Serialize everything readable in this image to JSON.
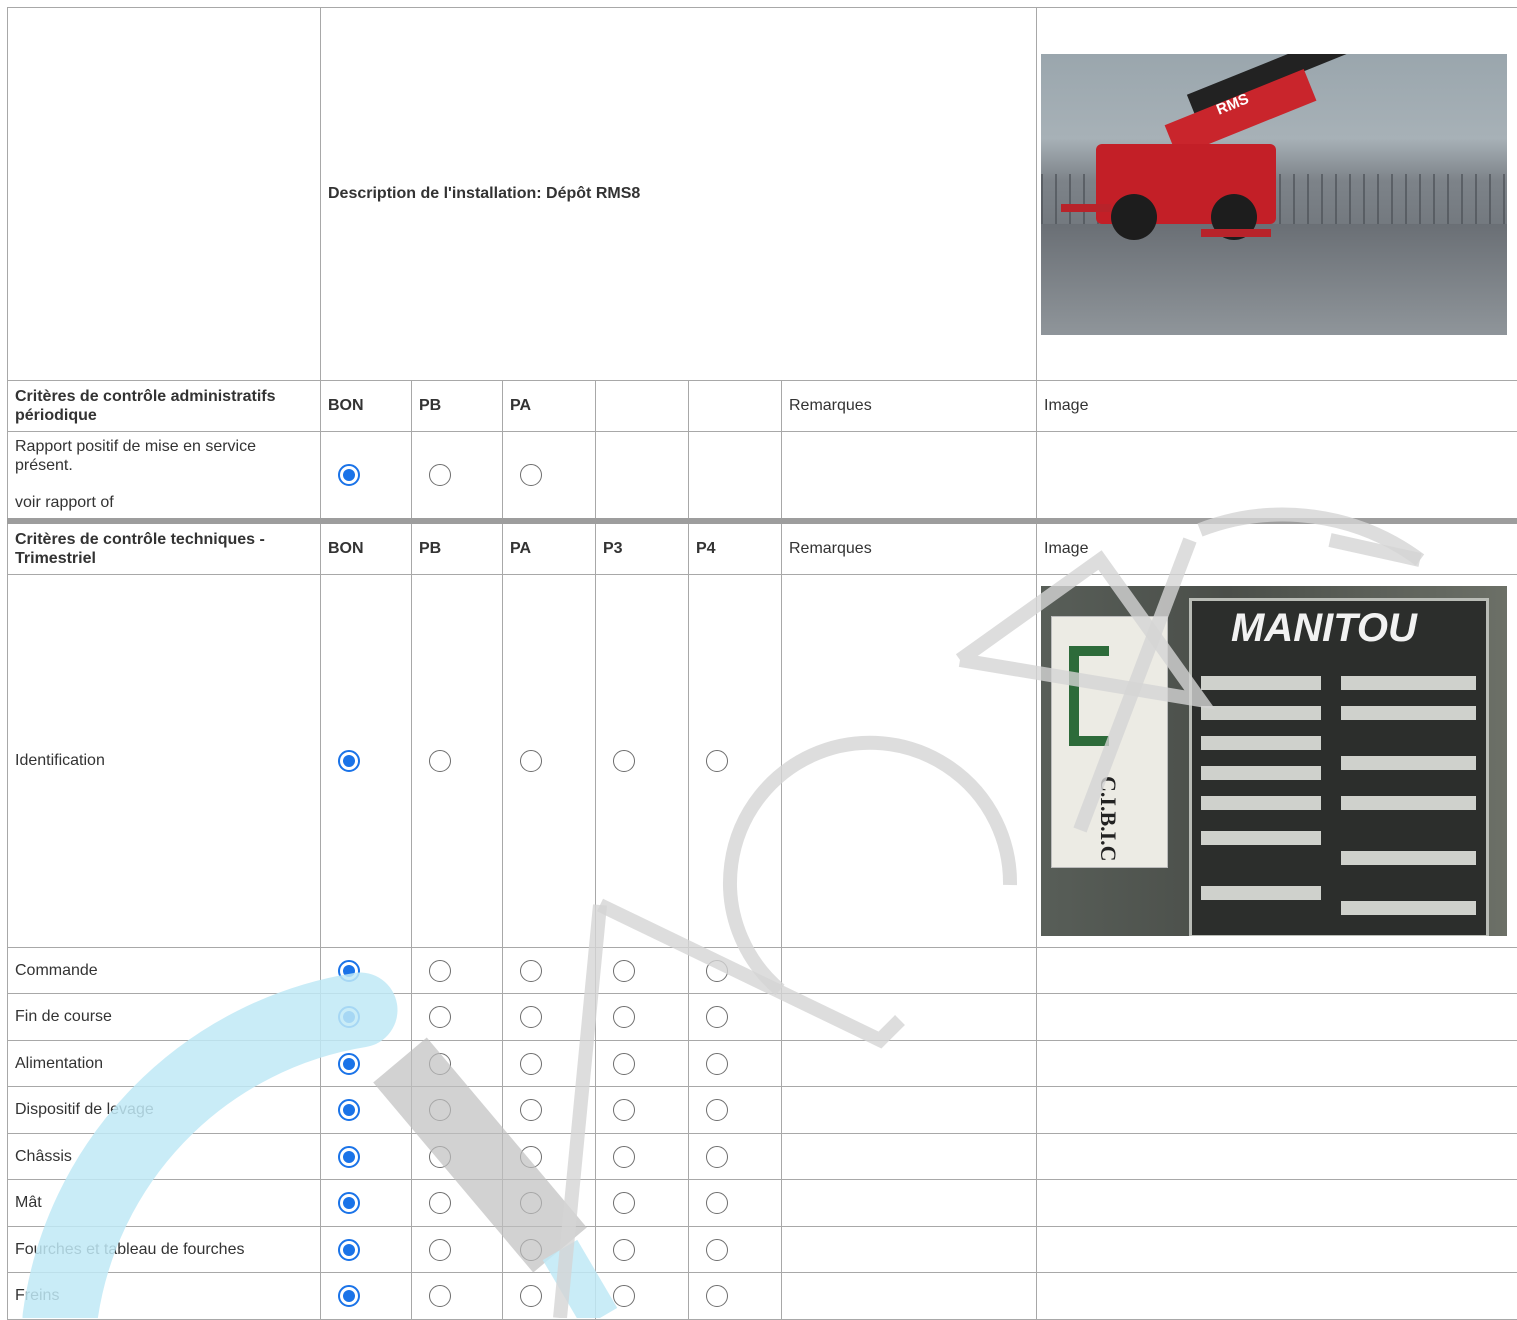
{
  "description": "Description de l'installation: Dépôt RMS8",
  "admin_header": {
    "title": "Critères de contrôle administratifs périodique",
    "cols": [
      "BON",
      "PB",
      "PA",
      "",
      ""
    ],
    "remarks": "Remarques",
    "image": "Image"
  },
  "admin_rows": [
    {
      "label": "Rapport positif de mise en service présent.",
      "note": "voir rapport of",
      "selected": 0
    }
  ],
  "tech_header": {
    "title": "Critères de contrôle techniques - Trimestriel",
    "cols": [
      "BON",
      "PB",
      "PA",
      "P3",
      "P4"
    ],
    "remarks": "Remarques",
    "image": "Image"
  },
  "tech_rows": [
    {
      "label": "Identification",
      "selected": 0
    },
    {
      "label": "Commande",
      "selected": 0
    },
    {
      "label": "Fin de course",
      "selected": 0
    },
    {
      "label": "Alimentation",
      "selected": 0
    },
    {
      "label": "Dispositif de levage",
      "selected": 0
    },
    {
      "label": "Châssis",
      "selected": 0
    },
    {
      "label": "Mât",
      "selected": 0
    },
    {
      "label": "Fourches et tableau de fourches",
      "selected": 0
    },
    {
      "label": "Freins",
      "selected": 0
    }
  ],
  "photos": {
    "machine_marking": "RMS",
    "plate_brand": "MANITOU",
    "sticker_text": "C.I.B.I.C"
  },
  "colors": {
    "radio_checked": "#1a73e8",
    "border": "#a8a8a8",
    "watermark_blue": "#c9ecf7",
    "watermark_gray": "#d0d0d0"
  }
}
